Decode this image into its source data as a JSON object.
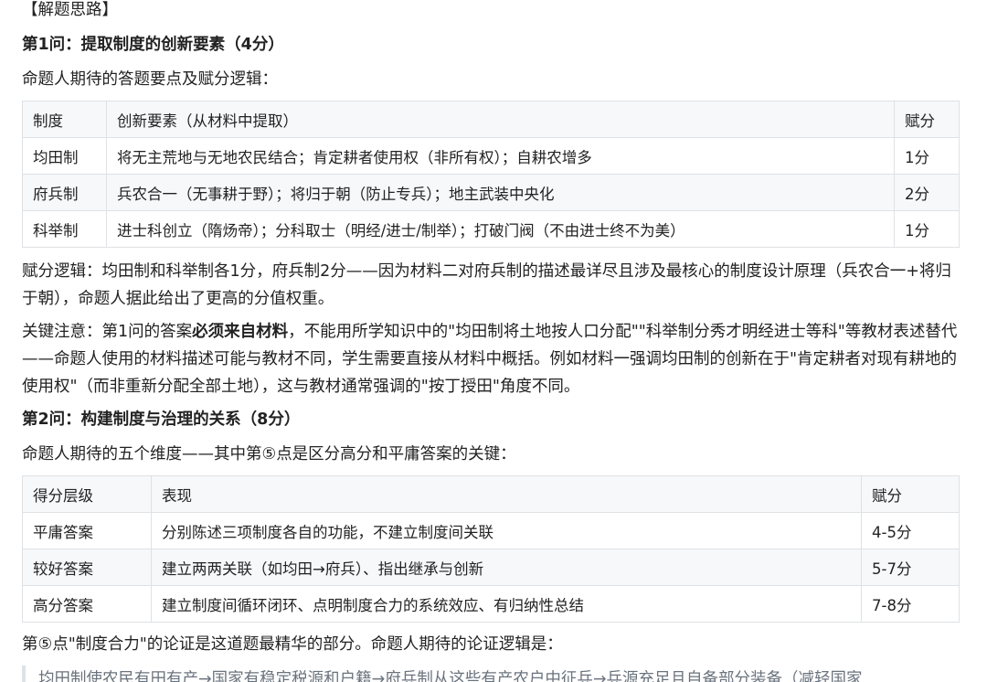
{
  "section_title": "【解题思路】",
  "q1": {
    "heading": "第1问：提取制度的创新要素（4分）",
    "intro": "命题人期待的答题要点及赋分逻辑：",
    "table": {
      "headers": [
        "制度",
        "创新要素（从材料中提取）",
        "赋分"
      ],
      "rows": [
        [
          "均田制",
          "将无主荒地与无地农民结合；肯定耕者使用权（非所有权）；自耕农增多",
          "1分"
        ],
        [
          "府兵制",
          "兵农合一（无事耕于野）；将归于朝（防止专兵）；地主武装中央化",
          "2分"
        ],
        [
          "科举制",
          "进士科创立（隋炀帝）；分科取士（明经/进士/制举）；打破门阀（不由进士终不为美）",
          "1分"
        ]
      ]
    },
    "logic": "赋分逻辑：均田制和科举制各1分，府兵制2分——因为材料二对府兵制的描述最详尽且涉及最核心的制度设计原理（兵农合一+将归于朝），命题人据此给出了更高的分值权重。",
    "note_before": "关键注意：第1问的答案",
    "note_bold": "必须来自材料",
    "note_after": "，不能用所学知识中的\"均田制将土地按人口分配\"\"科举制分秀才明经进士等科\"等教材表述替代——命题人使用的材料描述可能与教材不同，学生需要直接从材料中概括。例如材料一强调均田制的创新在于\"肯定耕者对现有耕地的使用权\"（而非重新分配全部土地），这与教材通常强调的\"按丁授田\"角度不同。"
  },
  "q2": {
    "heading": "第2问：构建制度与治理的关系（8分）",
    "intro": "命题人期待的五个维度——其中第⑤点是区分高分和平庸答案的关键：",
    "table": {
      "headers": [
        "得分层级",
        "表现",
        "赋分"
      ],
      "rows": [
        [
          "平庸答案",
          "分别陈述三项制度各自的功能，不建立制度间关联",
          "4-5分"
        ],
        [
          "较好答案",
          "建立两两关联（如均田→府兵）、指出继承与创新",
          "5-7分"
        ],
        [
          "高分答案",
          "建立制度间循环闭环、点明制度合力的系统效应、有归纳性总结",
          "7-8分"
        ]
      ]
    },
    "point5": "第⑤点\"制度合力\"的论证是这道题最精华的部分。命题人期待的论证逻辑是：",
    "quote": "均田制使农民有田有产→国家有稳定税源和户籍→府兵制从这些有产农户中征兵→兵源充足且自备部分装备（减轻国家"
  }
}
